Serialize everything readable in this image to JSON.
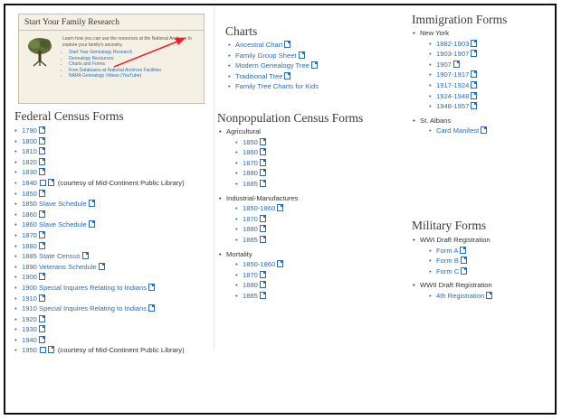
{
  "promo": {
    "title": "Start Your Family Research",
    "text": "Learn how you can use the resources at the National Archives to explore your family's ancestry.",
    "links": [
      "Start Your Genealogy Research",
      "Genealogy Resources",
      "Charts and Forms",
      "Free Databases at National Archives Facilities",
      "NARA Genealogy Videos (YouTube)"
    ]
  },
  "federal": {
    "heading": "Federal Census Forms",
    "items": [
      {
        "label": "1790"
      },
      {
        "label": "1800"
      },
      {
        "label": "1810"
      },
      {
        "label": "1820"
      },
      {
        "label": "1830"
      },
      {
        "label": "1840",
        "note": "(courtesy of Mid-Continent Public Library)"
      },
      {
        "label": "1850"
      },
      {
        "label": "1850 Slave Schedule"
      },
      {
        "label": "1860"
      },
      {
        "label": "1860 Slave Schedule"
      },
      {
        "label": "1870"
      },
      {
        "label": "1880"
      },
      {
        "label": "1885 State Census"
      },
      {
        "label": "1890 Veterans Schedule"
      },
      {
        "label": "1900"
      },
      {
        "label": "1900 Special Inquires Relating to Indians"
      },
      {
        "label": "1910"
      },
      {
        "label": "1910 Special Inquires Relating to Indians"
      },
      {
        "label": "1920"
      },
      {
        "label": "1930"
      },
      {
        "label": "1940"
      },
      {
        "label": "1950",
        "note": "(courtesy of Mid-Continent Public Library)"
      }
    ]
  },
  "charts": {
    "heading": "Charts",
    "items": [
      "Ancestral Chart",
      "Family Group Sheet",
      "Modern Genealogy Tree",
      "Traditional Tree",
      "Family Tree Charts for Kids"
    ]
  },
  "nonpop": {
    "heading": "Nonpopulation Census Forms",
    "groups": [
      {
        "label": "Agricultural",
        "items": [
          "1850",
          "1860",
          "1870",
          "1880",
          "1885"
        ]
      },
      {
        "label": "Industrial-Manufactures",
        "items": [
          "1850-1860",
          "1870",
          "1880",
          "1885"
        ]
      },
      {
        "label": "Mortality",
        "items": [
          "1850-1860",
          "1870",
          "1880",
          "1885"
        ]
      }
    ]
  },
  "immigration": {
    "heading": "Immigration Forms",
    "groups": [
      {
        "label": "New York",
        "items": [
          "1882-1903",
          "1903-1907",
          "1907",
          "1907-1917",
          "1917-1924",
          "1924-1948",
          "1948-1957"
        ]
      },
      {
        "label": "St. Albans",
        "items": [
          "Card Manifest"
        ]
      }
    ]
  },
  "military": {
    "heading": "Military Forms",
    "groups": [
      {
        "label": "WWI Draft Registration",
        "items": [
          "Form A",
          "Form B",
          "Form C"
        ]
      },
      {
        "label": "WWII Draft Registration",
        "items": [
          "4th Registration"
        ]
      }
    ]
  },
  "colors": {
    "link": "#2a6ebb",
    "arrow": "#e8232a",
    "promo_bg": "#f5f0e4"
  }
}
